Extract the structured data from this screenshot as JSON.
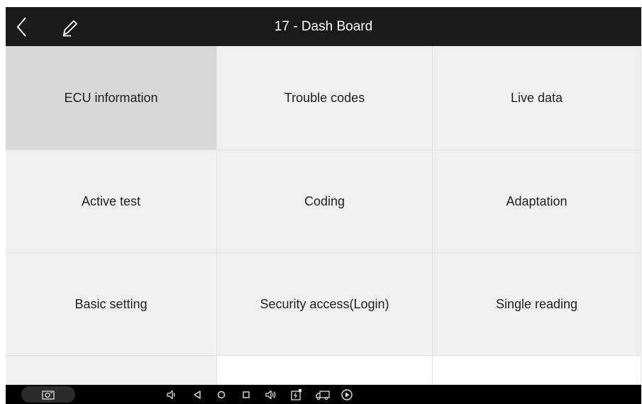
{
  "header": {
    "title": "17 - Dash Board",
    "back_icon": "chevron-left-icon",
    "edit_icon": "pencil-icon"
  },
  "functions": [
    {
      "label": "ECU information",
      "selected": true
    },
    {
      "label": "Trouble codes",
      "selected": false
    },
    {
      "label": "Live data",
      "selected": false
    },
    {
      "label": "Active test",
      "selected": false
    },
    {
      "label": "Coding",
      "selected": false
    },
    {
      "label": "Adaptation",
      "selected": false
    },
    {
      "label": "Basic setting",
      "selected": false
    },
    {
      "label": "Security access(Login)",
      "selected": false
    },
    {
      "label": "Single reading",
      "selected": false
    }
  ],
  "navbar": {
    "icons": [
      "camera-icon",
      "volume-down-icon",
      "back-triangle-icon",
      "home-circle-icon",
      "recents-square-icon",
      "volume-up-icon",
      "vci-icon",
      "truck-icon",
      "play-icon"
    ]
  },
  "colors": {
    "titlebar": "#1a1a1a",
    "tile": "#f0f0f0",
    "tile_selected": "#d7d7d7",
    "navbar": "#000000"
  }
}
